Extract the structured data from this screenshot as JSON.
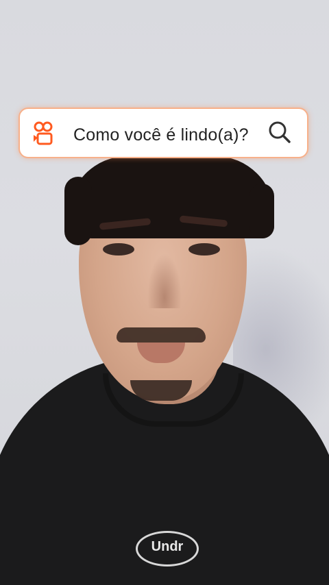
{
  "overlay": {
    "query_text": "Como você é lindo(a)?",
    "brand_icon": "kwai-camera-icon",
    "search_icon": "search-icon",
    "accent_color": "#ff5a1f",
    "border_color": "#f7b08a"
  },
  "shirt_print": {
    "logo_text": "Undr"
  }
}
